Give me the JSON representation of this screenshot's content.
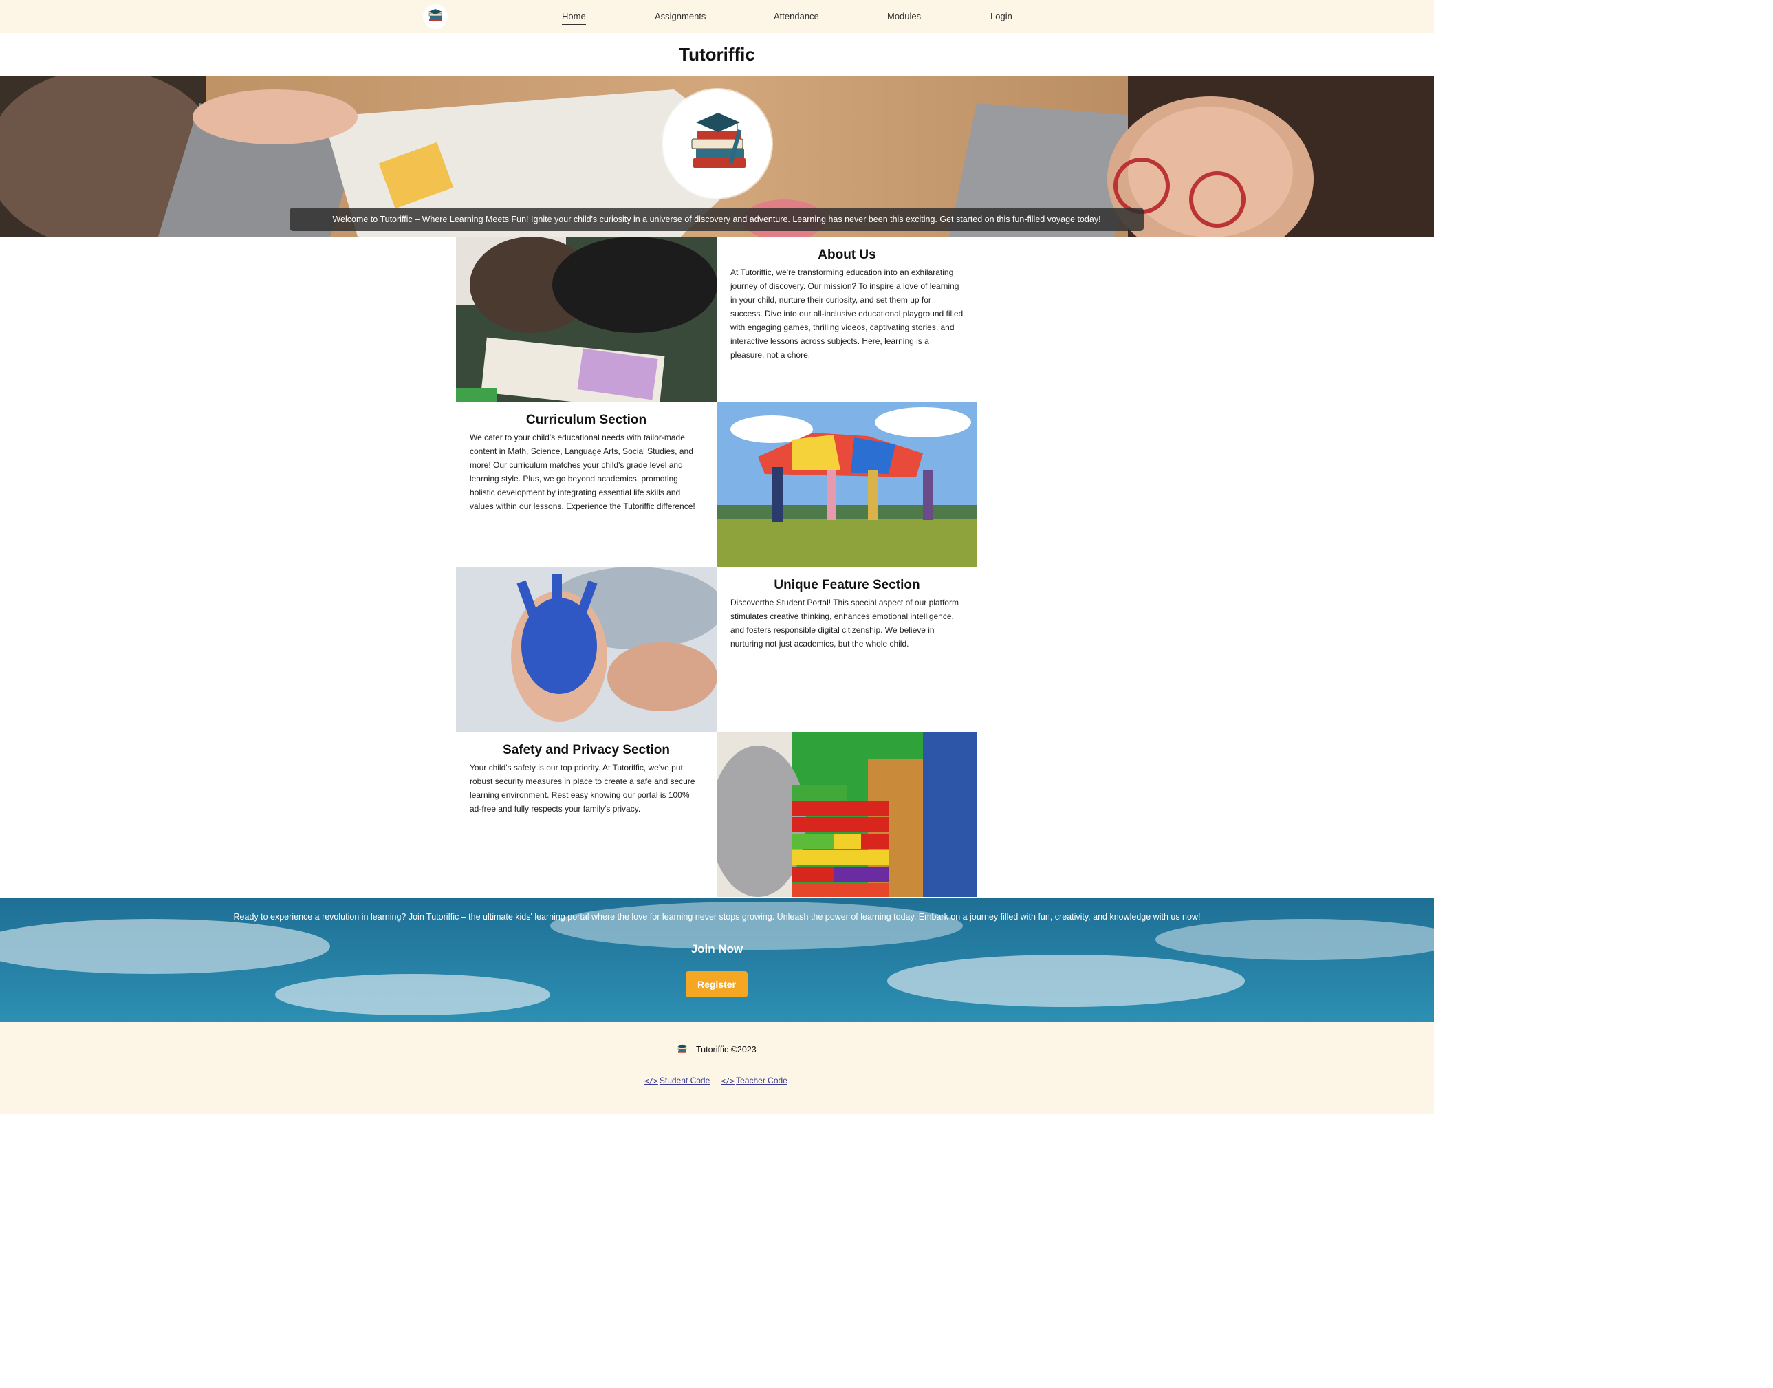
{
  "nav": {
    "logo_icon": "books-graduation-cap-icon",
    "items": [
      {
        "label": "Home",
        "active": true
      },
      {
        "label": "Assignments"
      },
      {
        "label": "Attendance"
      },
      {
        "label": "Modules"
      },
      {
        "label": "Login"
      }
    ]
  },
  "site_title": "Tutoriffic",
  "hero": {
    "welcome": "Welcome to Tutoriffic – Where Learning Meets Fun! Ignite your child's curiosity in a universe of discovery and adventure. Learning has never been this exciting. Get started on this fun-filled voyage today!",
    "logo_icon": "books-graduation-cap-icon"
  },
  "sections": {
    "about": {
      "heading": "About Us",
      "body": "At Tutoriffic, we're transforming education into an exhilarating journey of discovery. Our mission? To inspire a love of learning in your child, nurture their curiosity, and set them up for success. Dive into our all-inclusive educational playground filled with engaging games, thrilling videos, captivating stories, and interactive lessons across subjects. Here, learning is a pleasure, not a chore."
    },
    "curriculum": {
      "heading": "Curriculum Section",
      "body": "We cater to your child's educational needs with tailor-made content in Math, Science, Language Arts, Social Studies, and more! Our curriculum matches your child's grade level and learning style. Plus, we go beyond academics, promoting holistic development by integrating essential life skills and values within our lessons. Experience the Tutoriffic difference!"
    },
    "unique": {
      "heading": "Unique Feature Section",
      "body": "Discoverthe Student Portal! This special aspect of our platform stimulates creative thinking, enhances emotional intelligence, and fosters responsible digital citizenship. We believe in nurturing not just academics, but the whole child."
    },
    "safety": {
      "heading": "Safety and Privacy Section",
      "body": "Your child's safety is our top priority. At Tutoriffic, we've put robust security measures in place to create a safe and secure learning environment. Rest easy knowing our portal is 100% ad-free and fully respects your family's privacy."
    }
  },
  "cta": {
    "text": "Ready to experience a revolution in learning? Join Tutoriffic – the ultimate kids' learning portal where the love for learning never stops growing. Unleash the power of learning today. Embark on a journey filled with fun, creativity, and knowledge with us now!",
    "join": "Join Now",
    "register": "Register"
  },
  "footer": {
    "brand": "Tutoriffic ©2023",
    "links": [
      {
        "label": "Student Code",
        "icon": "code-icon"
      },
      {
        "label": "Teacher Code",
        "icon": "code-icon"
      }
    ]
  },
  "colors": {
    "nav_bg": "#fdf6e6",
    "button": "#f5a623",
    "cta_sky": "#2a7fa6"
  }
}
